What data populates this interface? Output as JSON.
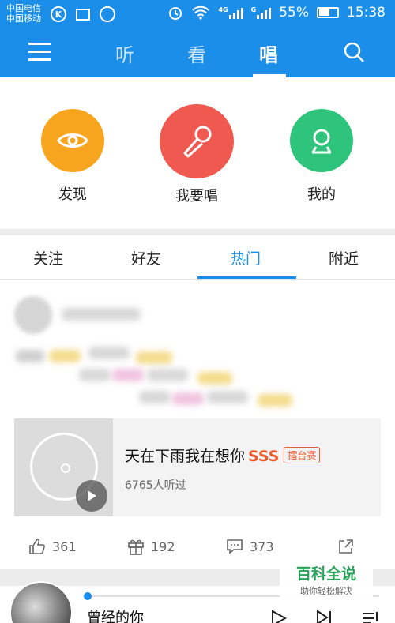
{
  "status_bar": {
    "carrier_1": "中国电信",
    "carrier_2": "中国移动",
    "k_glyph": "K",
    "network_4g": "4G",
    "network_g": "G",
    "battery": "55%",
    "time": "15:38"
  },
  "top_nav": {
    "tabs": [
      {
        "label": "听"
      },
      {
        "label": "看"
      },
      {
        "label": "唱"
      }
    ],
    "active_tab": "唱"
  },
  "features": [
    {
      "label": "发现",
      "icon": "eye-icon",
      "color": "#f7a51e"
    },
    {
      "label": "我要唱",
      "icon": "microphone-icon",
      "color": "#f0594f"
    },
    {
      "label": "我的",
      "icon": "user-icon",
      "color": "#2ec47b"
    }
  ],
  "sub_tabs": [
    {
      "label": "关注"
    },
    {
      "label": "好友"
    },
    {
      "label": "热门"
    },
    {
      "label": "附近"
    }
  ],
  "post": {
    "song": {
      "title": "天在下雨我在想你",
      "tag": "SSS",
      "badge": "擂台赛",
      "listens": "6765人听过"
    },
    "actions": {
      "likes": "361",
      "gifts": "192",
      "comments": "373"
    }
  },
  "player": {
    "title": "曾经的你",
    "progress": 0
  },
  "watermark": {
    "title": "百科全说",
    "subtitle": "助你轻松解决"
  },
  "colors": {
    "primary": "#1a8ee8",
    "accent_red": "#f0582e"
  }
}
